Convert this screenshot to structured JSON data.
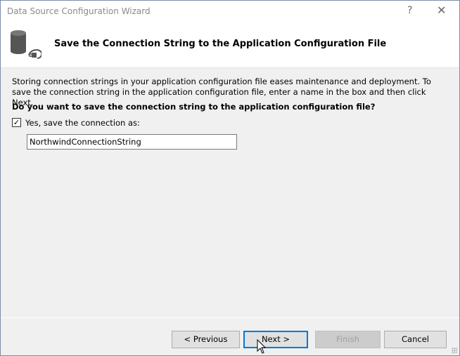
{
  "window": {
    "title": "Data Source Configuration Wizard",
    "help": "?",
    "close": "✕"
  },
  "header": {
    "title": "Save the Connection String to the Application Configuration File"
  },
  "body": {
    "description": "Storing connection strings in your application configuration file eases maintenance and deployment. To save the connection string in the application configuration file, enter a name in the box and then click Next.",
    "question": "Do you want to save the connection string to the application configuration file?",
    "checkbox_label": "Yes, save the connection as:",
    "checkbox_checked": true,
    "connection_name": "NorthwindConnectionString"
  },
  "buttons": {
    "previous": "< Previous",
    "next": "Next >",
    "finish": "Finish",
    "cancel": "Cancel"
  }
}
